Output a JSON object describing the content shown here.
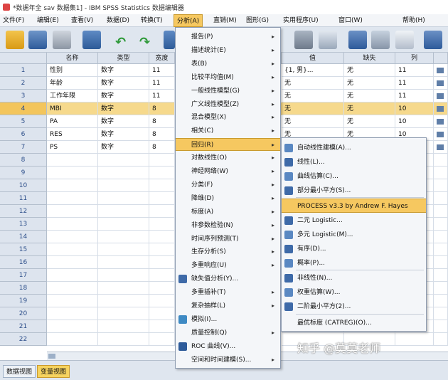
{
  "window": {
    "title": "*数据年全 sav 数据集1] - IBM SPSS Statistics 数据编辑器"
  },
  "menubar": {
    "items": [
      "文件(F)",
      "编辑(E)",
      "查看(V)",
      "数据(D)",
      "转换(T)",
      "分析(A)",
      "直销(M)",
      "图形(G)",
      "实用程序(U)",
      "窗口(W)",
      "帮助(H)"
    ],
    "active_index": 5
  },
  "grid": {
    "headers": {
      "name": "名称",
      "type": "类型",
      "width": "宽度",
      "values": "值",
      "missing": "缺失",
      "columns": "列"
    },
    "rows": [
      {
        "num": "1",
        "name": "性别",
        "type": "数字",
        "width": "11",
        "values": "{1, 男}...",
        "missing": "无",
        "columns": "11"
      },
      {
        "num": "2",
        "name": "年龄",
        "type": "数字",
        "width": "11",
        "values": "无",
        "missing": "无",
        "columns": "11"
      },
      {
        "num": "3",
        "name": "工作年限",
        "type": "数字",
        "width": "11",
        "values": "无",
        "missing": "无",
        "columns": "11"
      },
      {
        "num": "4",
        "name": "MBI",
        "type": "数字",
        "width": "8",
        "values": "无",
        "missing": "无",
        "columns": "10"
      },
      {
        "num": "5",
        "name": "PA",
        "type": "数字",
        "width": "8",
        "values": "无",
        "missing": "无",
        "columns": "10"
      },
      {
        "num": "6",
        "name": "RES",
        "type": "数字",
        "width": "8",
        "values": "无",
        "missing": "无",
        "columns": "10"
      },
      {
        "num": "7",
        "name": "PS",
        "type": "数字",
        "width": "8",
        "values": "无",
        "missing": "无",
        "columns": "10"
      },
      {
        "num": "8"
      },
      {
        "num": "9"
      },
      {
        "num": "10"
      },
      {
        "num": "11"
      },
      {
        "num": "12"
      },
      {
        "num": "13"
      },
      {
        "num": "14"
      },
      {
        "num": "15"
      },
      {
        "num": "16"
      },
      {
        "num": "17"
      },
      {
        "num": "18"
      },
      {
        "num": "19"
      },
      {
        "num": "20"
      },
      {
        "num": "21"
      },
      {
        "num": "22"
      }
    ],
    "selected_row": 4
  },
  "analyze_menu": {
    "items": [
      {
        "label": "报告(P)",
        "submenu": true
      },
      {
        "label": "描述统计(E)",
        "submenu": true
      },
      {
        "label": "表(B)",
        "submenu": true
      },
      {
        "label": "比较平均值(M)",
        "submenu": true
      },
      {
        "label": "一般线性模型(G)",
        "submenu": true
      },
      {
        "label": "广义线性模型(Z)",
        "submenu": true
      },
      {
        "label": "混合模型(X)",
        "submenu": true
      },
      {
        "label": "相关(C)",
        "submenu": true
      },
      {
        "label": "回归(R)",
        "submenu": true,
        "highlighted": true
      },
      {
        "label": "对数线性(O)",
        "submenu": true
      },
      {
        "label": "神经网络(W)",
        "submenu": true
      },
      {
        "label": "分类(F)",
        "submenu": true
      },
      {
        "label": "降维(D)",
        "submenu": true
      },
      {
        "label": "标度(A)",
        "submenu": true
      },
      {
        "label": "非参数检验(N)",
        "submenu": true
      },
      {
        "label": "时间序列预测(T)",
        "submenu": true
      },
      {
        "label": "生存分析(S)",
        "submenu": true
      },
      {
        "label": "多重响应(U)",
        "submenu": true
      },
      {
        "label": "缺失值分析(Y)...",
        "submenu": false,
        "icon": "missing-value-icon"
      },
      {
        "label": "多重插补(T)",
        "submenu": true
      },
      {
        "label": "复杂抽样(L)",
        "submenu": true
      },
      {
        "label": "模拟(I)...",
        "submenu": false,
        "icon": "simulation-icon"
      },
      {
        "label": "质量控制(Q)",
        "submenu": true
      },
      {
        "label": "ROC 曲线(V)...",
        "submenu": false,
        "icon": "roc-curve-icon"
      },
      {
        "label": "空间和时间建模(S)...",
        "submenu": true
      }
    ]
  },
  "regression_submenu": {
    "items": [
      {
        "label": "自动线性建模(A)...",
        "icon": "auto-linear-icon"
      },
      {
        "label": "线性(L)...",
        "icon": "linear-icon"
      },
      {
        "label": "曲线估算(C)...",
        "icon": "curve-estimation-icon"
      },
      {
        "label": "部分最小平方(S)...",
        "icon": "partial-least-squares-icon"
      },
      {
        "label": "PROCESS v3.3 by Andrew F. Hayes",
        "icon": "",
        "highlighted": true
      },
      {
        "label": "二元 Logistic...",
        "icon": "binary-logistic-icon"
      },
      {
        "label": "多元 Logistic(M)...",
        "icon": "multinomial-logistic-icon"
      },
      {
        "label": "有序(D)...",
        "icon": "ordinal-icon"
      },
      {
        "label": "概率(P)...",
        "icon": "probit-icon"
      },
      {
        "label": "非线性(N)...",
        "icon": "nonlinear-icon"
      },
      {
        "label": "权重估算(W)...",
        "icon": "weight-estimation-icon"
      },
      {
        "label": "二阶最小平方(2)...",
        "icon": "two-stage-least-squares-icon"
      },
      {
        "label": "最优标度 (CATREG)(O)...",
        "icon": ""
      }
    ]
  },
  "tabs": {
    "data_view": "数据视图",
    "variable_view": "变量视图"
  },
  "watermark": "知乎 @莫莫老师",
  "colors": {
    "highlight": "#f6c860",
    "row_highlight": "#f6d98c",
    "accent_blue": "#2e5b9a"
  }
}
